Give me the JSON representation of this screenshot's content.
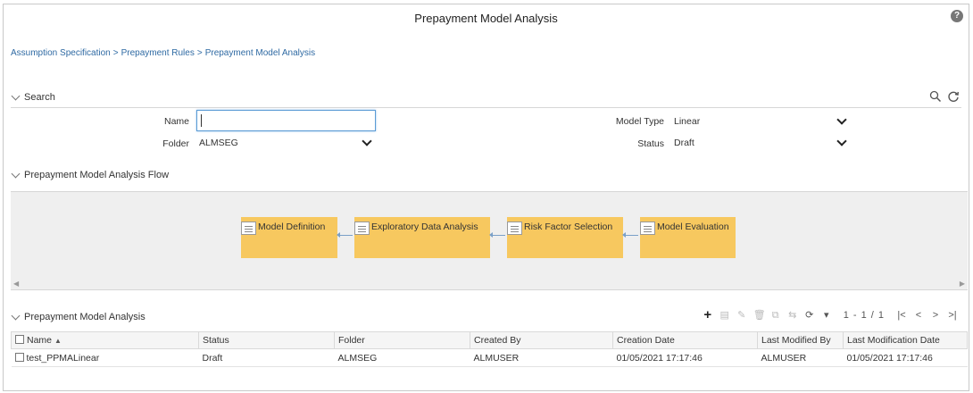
{
  "header": {
    "title": "Prepayment Model Analysis",
    "help_icon": "question-circle-icon"
  },
  "breadcrumb": {
    "items": [
      "Assumption Specification",
      "Prepayment Rules",
      "Prepayment Model Analysis"
    ],
    "separator": ">"
  },
  "search": {
    "title": "Search",
    "name_label": "Name",
    "name_value": "",
    "folder_label": "Folder",
    "folder_value": "ALMSEG",
    "model_type_label": "Model Type",
    "model_type_value": "Linear",
    "status_label": "Status",
    "status_value": "Draft",
    "icons": [
      "search-icon",
      "refresh-icon"
    ]
  },
  "flow": {
    "title": "Prepayment Model Analysis Flow",
    "steps": [
      {
        "label": "Model Definition"
      },
      {
        "label": "Exploratory Data Analysis"
      },
      {
        "label": "Risk Factor Selection"
      },
      {
        "label": "Model Evaluation"
      }
    ],
    "box_color": "#f7c85f"
  },
  "grid": {
    "title": "Prepayment Model Analysis",
    "pager": "1 - 1 / 1",
    "columns": [
      "Name",
      "Status",
      "Folder",
      "Created By",
      "Creation Date",
      "Last Modified By",
      "Last Modification Date"
    ],
    "rows": [
      [
        "test_PPMALinear",
        "Draft",
        "ALMSEG",
        "ALMUSER",
        "01/05/2021 17:17:46",
        "ALMUSER",
        "01/05/2021 17:17:46"
      ]
    ]
  },
  "colors": {
    "link": "#2f6aa3",
    "accent": "#5b9bd5"
  }
}
